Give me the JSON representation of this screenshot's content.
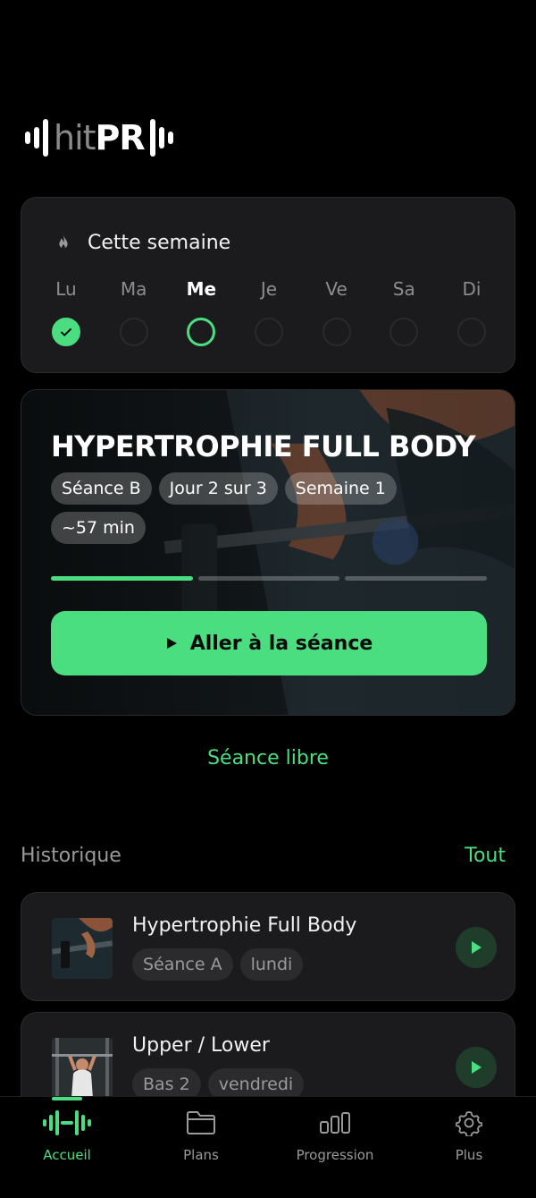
{
  "logo": {
    "hit": "hit",
    "pr": "PR"
  },
  "week": {
    "title": "Cette semaine",
    "icon": "flame-icon",
    "days": [
      {
        "label": "Lu",
        "state": "done"
      },
      {
        "label": "Ma",
        "state": "empty"
      },
      {
        "label": "Me",
        "state": "today"
      },
      {
        "label": "Je",
        "state": "empty"
      },
      {
        "label": "Ve",
        "state": "empty"
      },
      {
        "label": "Sa",
        "state": "empty"
      },
      {
        "label": "Di",
        "state": "empty"
      }
    ]
  },
  "hero": {
    "title": "HYPERTROPHIE FULL BODY",
    "chips": [
      "Séance B",
      "Jour 2 sur 3",
      "Semaine 1",
      "~57 min"
    ],
    "progress_segments_total": 3,
    "progress_segments_done": 1,
    "button_label": "Aller à la séance"
  },
  "free_session": "Séance libre",
  "history": {
    "title": "Historique",
    "all_label": "Tout",
    "items": [
      {
        "name": "Hypertrophie Full Body",
        "tags": [
          "Séance A",
          "lundi"
        ]
      },
      {
        "name": "Upper / Lower",
        "tags": [
          "Bas 2",
          "vendredi"
        ]
      }
    ]
  },
  "tabs": [
    {
      "label": "Accueil",
      "icon": "dumbbell-icon",
      "active": true
    },
    {
      "label": "Plans",
      "icon": "folder-icon",
      "active": false
    },
    {
      "label": "Progression",
      "icon": "bar-chart-icon",
      "active": false
    },
    {
      "label": "Plus",
      "icon": "gear-icon",
      "active": false
    }
  ],
  "colors": {
    "accent": "#4ade80",
    "card": "#1b1b1d",
    "background": "#000000"
  }
}
